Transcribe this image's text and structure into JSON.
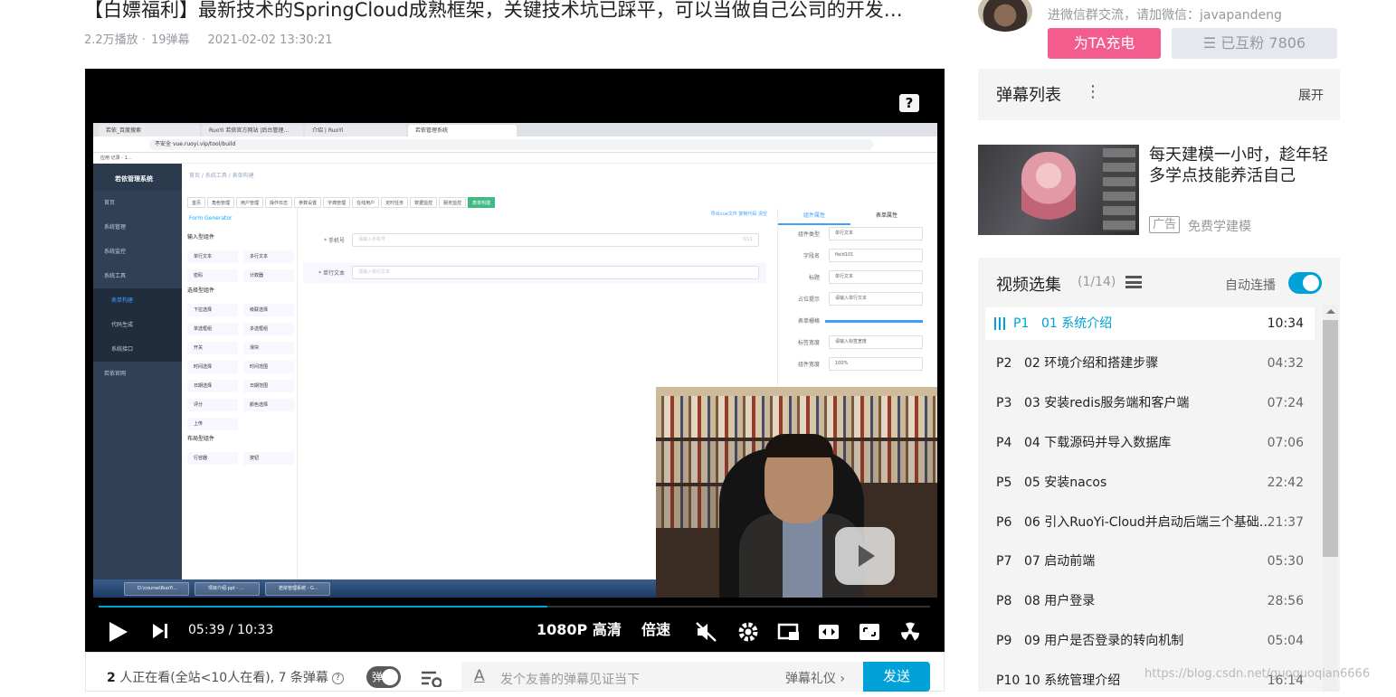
{
  "video": {
    "title": "【白嫖福利】最新技术的SpringCloud成熟框架，关键技术坑已踩平，可以当做自己公司的开发…",
    "plays": "2.2万播放 ·",
    "danmaku_count": "19弹幕",
    "date": "2021-02-02 13:30:21"
  },
  "player": {
    "help_label": "?",
    "current_time": "05:39",
    "separator": "/",
    "total_time": "10:33",
    "progress": 0.54,
    "quality": "1080P 高清",
    "speed": "倍速"
  },
  "screen": {
    "tabs": [
      "若依_百度搜索",
      "RuoYi 若依官方网站 |后台管理…",
      "介绍 | RuoYi",
      "若依管理系统"
    ],
    "url": "vue.ruoyi.vip/tool/build",
    "url_prefix": "不安全",
    "bookmarks": "应用  记录 - 1…",
    "app_name": "若依管理系统",
    "side_items": [
      "首页",
      "系统管理",
      "系统监控",
      "系统工具"
    ],
    "side_sub": [
      "表单构建",
      "代码生成",
      "系统接口"
    ],
    "side_last": "若依官网",
    "crumb": "首页 / 系统工具 / 表单构建",
    "tags": [
      "首页",
      "角色管理",
      "用户管理",
      "操作日志",
      "参数设置",
      "字典管理",
      "在线用户",
      "定时任务",
      "数据监控",
      "服务监控",
      "表单构建"
    ],
    "form_generator": "Form Generator",
    "actions": "导出vue文件   复制代码   清空",
    "group1": "输入型组件",
    "group1_items": [
      "单行文本",
      "多行文本",
      "密码",
      "计数器"
    ],
    "group2": "选择型组件",
    "group2_items": [
      "下拉选择",
      "级联选择",
      "单选框组",
      "多选框组",
      "开关",
      "滑块",
      "时间选择",
      "时间范围",
      "日期选择",
      "日期范围",
      "评分",
      "颜色选择",
      "上传"
    ],
    "group3": "布局型组件",
    "group3_items": [
      "行容器",
      "按钮"
    ],
    "field1_label": "* 手机号",
    "field1_ph": "请输入手机号",
    "field1_count": "0/11",
    "field2_label": "* 单行文本",
    "field2_ph": "请输入单行文本",
    "prop_tabs": [
      "组件属性",
      "表单属性"
    ],
    "props": [
      {
        "l": "组件类型",
        "v": "单行文本"
      },
      {
        "l": "字段名",
        "v": "field101"
      },
      {
        "l": "标题",
        "v": "单行文本"
      },
      {
        "l": "占位提示",
        "v": "请输入单行文本"
      },
      {
        "l": "表单栅格",
        "v": ""
      },
      {
        "l": "标签宽度",
        "v": "请输入标签宽度"
      },
      {
        "l": "组件宽度",
        "v": "100%"
      }
    ],
    "taskbar": [
      "D:\\course\\RuoYi...",
      "项目介绍.ppt - ...",
      "若依管理系统 - G..."
    ]
  },
  "below": {
    "viewers_count": "2",
    "viewers_text": " 人正在看(全站<10人在看), 7 条弹幕",
    "qmark": "?",
    "toggle": "弹",
    "placeholder": "发个友善的弹幕见证当下",
    "etiquette": "弹幕礼仪 ›",
    "send": "发送"
  },
  "up": {
    "sub": "进微信群交流，请加微信：javapandeng",
    "charge": "为TA充电",
    "follow": "☰ 已互粉 7806"
  },
  "danmaku_panel": {
    "title": "弹幕列表",
    "dots": "⋮",
    "expand": "展开"
  },
  "ad": {
    "title": "每天建模一小时，趁年轻多学点技能养活自己",
    "tag": "广告",
    "sub": "免费学建模"
  },
  "playlist": {
    "title": "视频选集",
    "count": "(1/14)",
    "autoplay": "自动连播",
    "episodes": [
      {
        "num": "P1",
        "name": "01 系统介绍",
        "dur": "10:34",
        "active": true
      },
      {
        "num": "P2",
        "name": "02 环境介绍和搭建步骤",
        "dur": "04:32"
      },
      {
        "num": "P3",
        "name": "03 安装redis服务端和客户端",
        "dur": "07:24"
      },
      {
        "num": "P4",
        "name": "04 下载源码并导入数据库",
        "dur": "07:06"
      },
      {
        "num": "P5",
        "name": "05 安装nacos",
        "dur": "22:42"
      },
      {
        "num": "P6",
        "name": "06 引入RuoYi-Cloud并启动后端三个基础服务",
        "dur": "21:37"
      },
      {
        "num": "P7",
        "name": "07 启动前端",
        "dur": "05:30"
      },
      {
        "num": "P8",
        "name": "08 用户登录",
        "dur": "28:56"
      },
      {
        "num": "P9",
        "name": "09 用户是否登录的转向机制",
        "dur": "05:04"
      },
      {
        "num": "P10",
        "name": "10 系统管理介绍",
        "dur": "16:14"
      }
    ]
  },
  "watermark": "https://blog.csdn.net/guoguoqian6666"
}
